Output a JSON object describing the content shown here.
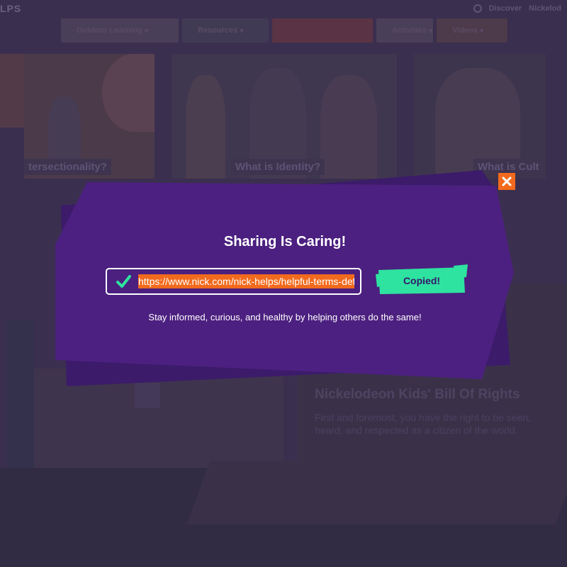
{
  "background": {
    "logo": "LPS",
    "top_right": {
      "discover_label": "Discover",
      "other_label": "Nickelod"
    },
    "nav": [
      {
        "label": "Outdoor Learning",
        "color": "#4a3f59"
      },
      {
        "label": "Resources",
        "color": "#413a55"
      },
      {
        "label": "",
        "color": "#5a3444"
      },
      {
        "label": "Activities",
        "color": "#4a3f59"
      },
      {
        "label": "Videos",
        "color": "#4d3a4a"
      }
    ],
    "cards": [
      {
        "caption": "tersectionality?"
      },
      {
        "caption": "What is Identity?"
      },
      {
        "caption": "What is Cult"
      }
    ],
    "feature": {
      "heading": "Nickelodeon Kids' Bill Of Rights",
      "paragraph": "First and foremost, you have the right to be seen, heard, and respected as a citizen of the world."
    }
  },
  "modal": {
    "title": "Sharing Is Caring!",
    "url": "https://www.nick.com/nick-helps/helpful-terms-defi",
    "copied_label": "Copied!",
    "subtitle": "Stay informed, curious, and healthy by helping others do the same!",
    "colors": {
      "panel": "#4c2080",
      "panel_back": "#3c1b6a",
      "accent_green": "#2ee3a0",
      "accent_orange": "#f26a1d"
    },
    "icons": {
      "close": "close-icon",
      "check": "check-icon"
    }
  }
}
